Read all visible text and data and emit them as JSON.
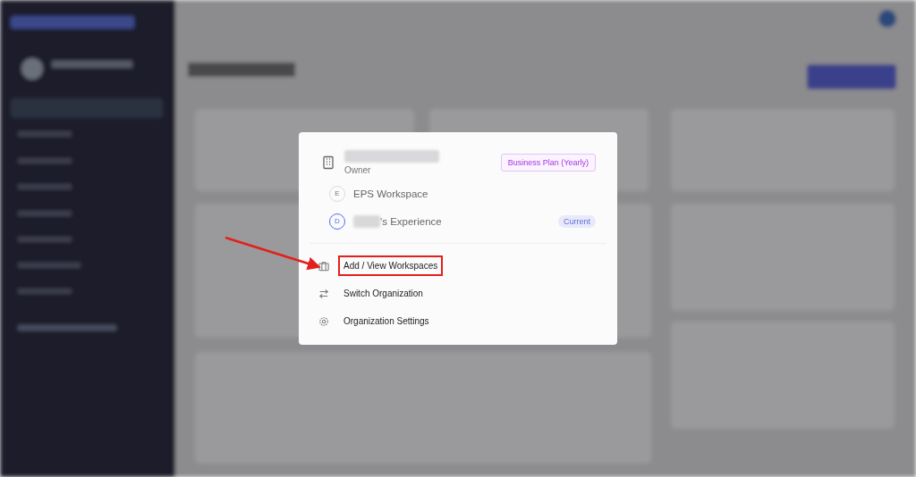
{
  "organization": {
    "name_redacted": true,
    "role": "Owner",
    "plan_badge": "Business Plan (Yearly)"
  },
  "workspaces": [
    {
      "initial": "E",
      "name": "EPS Workspace",
      "name_prefix_redacted": false,
      "selected": false
    },
    {
      "initial": "D",
      "name": "'s Experience",
      "name_prefix_redacted": true,
      "selected": true,
      "badge": "Current"
    }
  ],
  "actions": [
    {
      "kind": "briefcase",
      "label": "Add / View Workspaces",
      "highlighted": true
    },
    {
      "kind": "switch",
      "label": "Switch Organization",
      "highlighted": false
    },
    {
      "kind": "gear",
      "label": "Organization Settings",
      "highlighted": false
    }
  ]
}
